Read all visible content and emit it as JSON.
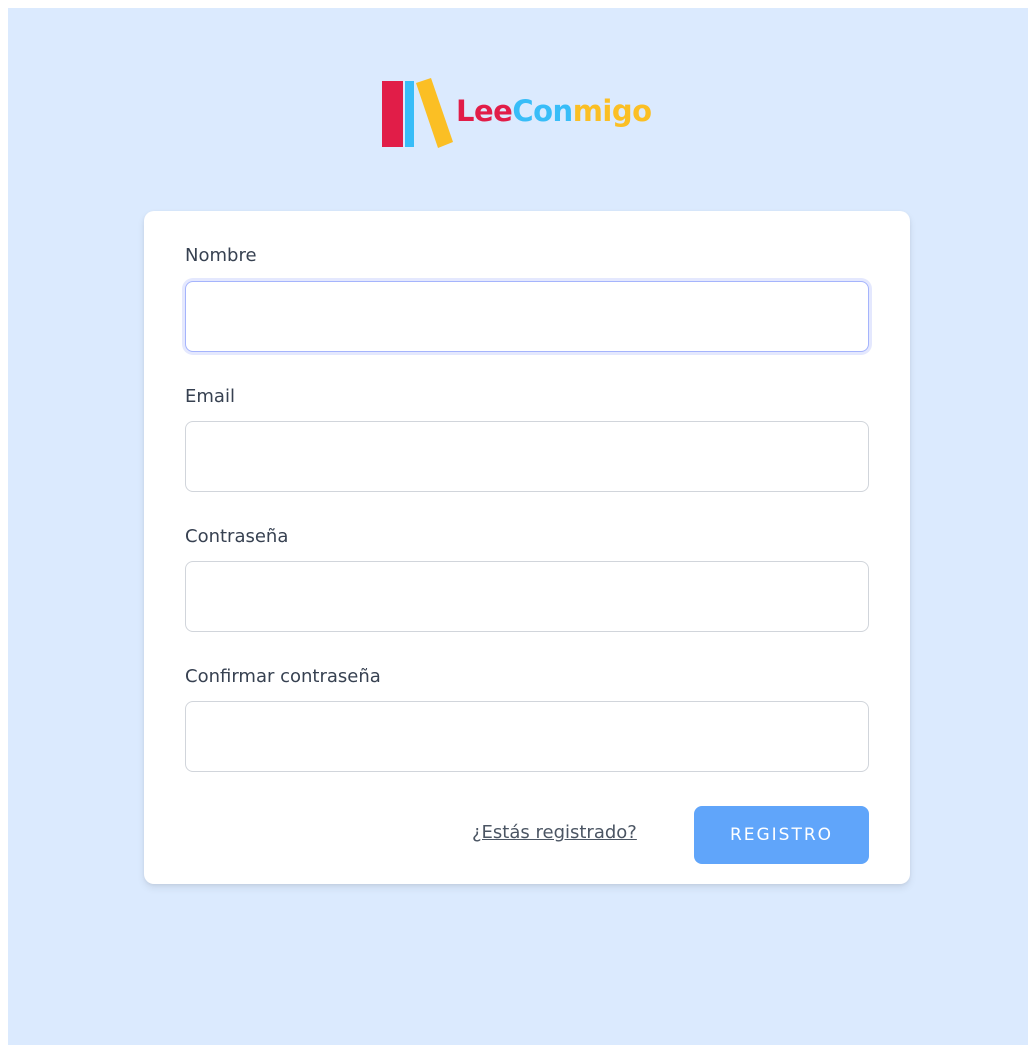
{
  "brand": {
    "parts": [
      "Lee",
      "Con",
      "migo"
    ],
    "colors": {
      "red": "#e11d48",
      "blue": "#38bdf8",
      "yellow": "#fbbf24"
    }
  },
  "form": {
    "fields": [
      {
        "label": "Nombre",
        "value": "",
        "type": "text",
        "focused": true
      },
      {
        "label": "Email",
        "value": "",
        "type": "email"
      },
      {
        "label": "Contraseña",
        "value": "",
        "type": "password"
      },
      {
        "label": "Confirmar contraseña",
        "value": "",
        "type": "password"
      }
    ],
    "login_link": "¿Estás registrado?",
    "submit_label": "REGISTRO"
  },
  "theme": {
    "background": "#dbeafe",
    "card": "#ffffff",
    "button": "#60a5fa"
  }
}
